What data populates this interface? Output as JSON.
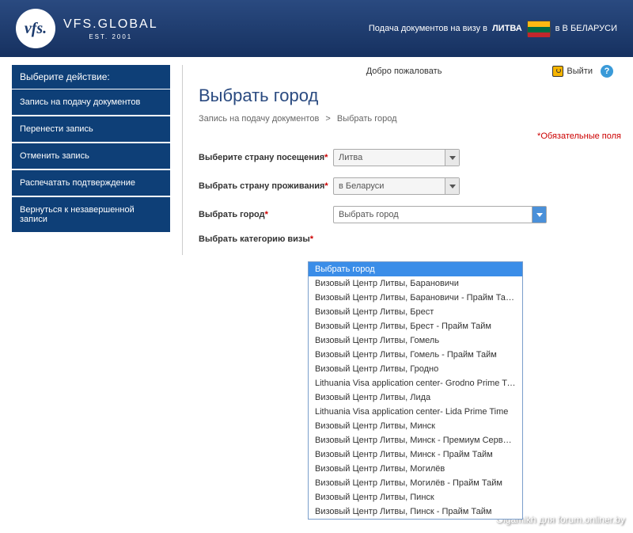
{
  "header": {
    "logo_abbrev": "vfs.",
    "brand": "VFS.GLOBAL",
    "est": "EST. 2001",
    "context_prefix": "Подача документов на визу в",
    "context_country": "ЛИТВА",
    "context_suffix": "в В БЕЛАРУСИ"
  },
  "topbar": {
    "welcome": "Добро пожаловать",
    "logout": "Выйти",
    "help": "?"
  },
  "sidebar": {
    "title": "Выберите действие:",
    "items": [
      {
        "label": "Запись на подачу документов"
      },
      {
        "label": "Перенести запись"
      },
      {
        "label": "Отменить запись"
      },
      {
        "label": "Распечатать подтверждение"
      },
      {
        "label": "Вернуться к незавершенной записи"
      }
    ]
  },
  "page": {
    "title": "Выбрать город",
    "breadcrumb_a": "Запись на подачу документов",
    "breadcrumb_sep": ">",
    "breadcrumb_b": "Выбрать город",
    "mandatory": "Обязательные поля"
  },
  "form": {
    "country_visit_label": "Выберите страну посещения",
    "country_visit_value": "Литва",
    "country_reside_label": "Выбрать страну проживания",
    "country_reside_value": "в Беларуси",
    "city_label": "Выбрать город",
    "city_value": "Выбрать город",
    "visa_cat_label": "Выбрать категорию визы",
    "city_options": [
      "Выбрать город",
      "Визовый Центр Литвы, Барановичи",
      "Визовый Центр Литвы, Барановичи - Прайм Тайм",
      "Визовый Центр Литвы, Брест",
      "Визовый Центр Литвы, Брест - Прайм Тайм",
      "Визовый Центр Литвы, Гомель",
      "Визовый Центр Литвы, Гомель - Прайм Тайм",
      "Визовый Центр Литвы, Гродно",
      "Lithuania Visa application center- Grodno Prime Time",
      "Визовый Центр Литвы, Лида",
      "Lithuania Visa application center- Lida Prime Time",
      "Визовый Центр Литвы, Минск",
      "Визовый Центр Литвы, Минск - Премиум Сервис Зал",
      "Визовый Центр Литвы, Минск - Прайм Тайм",
      "Визовый Центр Литвы, Могилёв",
      "Визовый Центр Литвы, Могилёв - Прайм Тайм",
      "Визовый Центр Литвы, Пинск",
      "Визовый Центр Литвы, Пинск - Прайм Тайм"
    ]
  },
  "watermark": "Olgamikh для forum.onliner.by"
}
